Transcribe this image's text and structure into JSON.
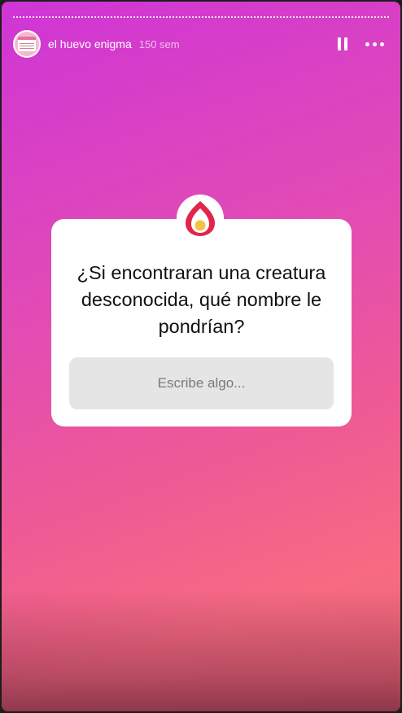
{
  "header": {
    "username": "el huevo enigma",
    "time_ago": "150 sem"
  },
  "question_sticker": {
    "question": "¿Si encontraran una creatura desconocida, qué nombre le pondrían?",
    "input_placeholder": "Escribe algo...",
    "badge_icon": "flame-egg-icon"
  },
  "colors": {
    "gradient_top": "#cf35d6",
    "gradient_bottom": "#f76a82",
    "badge_red": "#e0264b",
    "badge_yellow": "#f6c244"
  }
}
